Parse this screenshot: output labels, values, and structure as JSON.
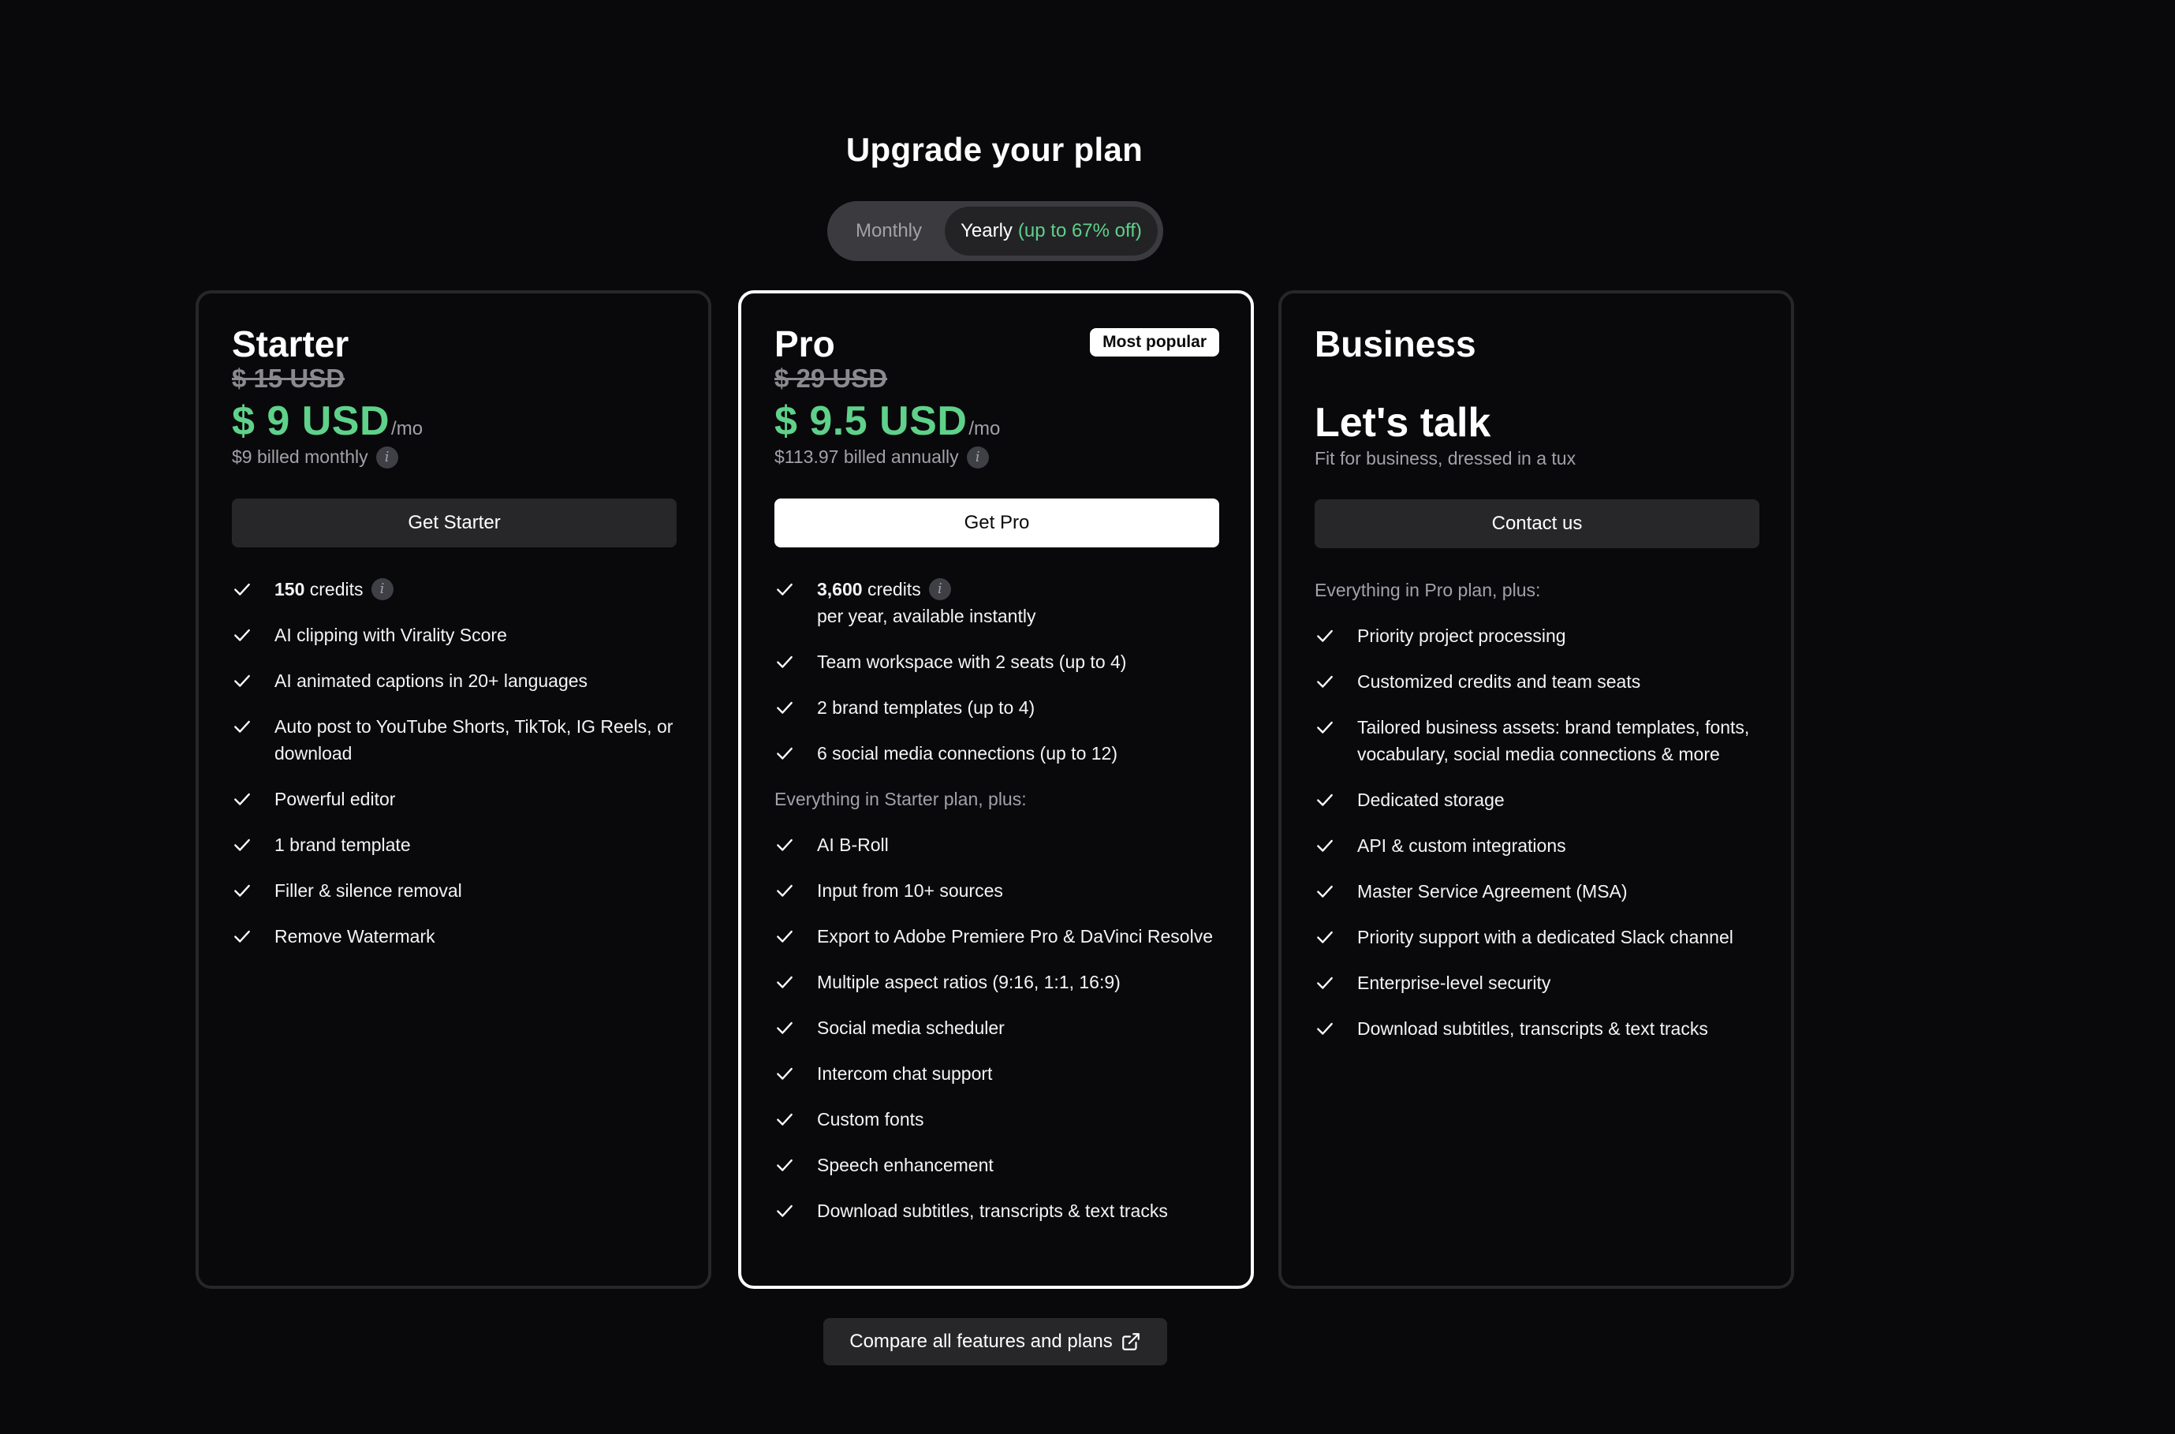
{
  "header": {
    "title": "Upgrade your plan",
    "billing_toggle": {
      "monthly_label": "Monthly",
      "yearly_label": "Yearly",
      "yearly_discount": "(up to 67% off)",
      "selected": "Yearly"
    }
  },
  "colors": {
    "background": "#09090b",
    "price_green": "#5fd18a",
    "card_border": "#27272a",
    "pro_border": "#ffffff"
  },
  "plans": {
    "starter": {
      "name": "Starter",
      "old_price": "$ 15 USD",
      "price": "$ 9 USD",
      "per": "/mo",
      "billed": "$9 billed monthly",
      "cta": "Get Starter",
      "features": [
        {
          "strong": "150",
          "text": " credits",
          "info": true
        },
        {
          "text": "AI clipping with Virality Score"
        },
        {
          "text": "AI animated captions in 20+ languages"
        },
        {
          "text": "Auto post to YouTube Shorts, TikTok, IG Reels, or download"
        },
        {
          "text": "Powerful editor"
        },
        {
          "text": "1 brand template"
        },
        {
          "text": "Filler & silence removal"
        },
        {
          "text": "Remove Watermark"
        }
      ]
    },
    "pro": {
      "name": "Pro",
      "badge": "Most popular",
      "old_price": "$ 29 USD",
      "price": "$ 9.5 USD",
      "per": "/mo",
      "billed": "$113.97 billed annually",
      "cta": "Get Pro",
      "features_top": [
        {
          "strong": "3,600",
          "text": " credits",
          "info": true,
          "sub": "per year, available instantly"
        },
        {
          "text": "Team workspace with 2 seats (up to 4)"
        },
        {
          "text": "2 brand templates (up to 4)"
        },
        {
          "text": "6 social media connections (up to 12)"
        }
      ],
      "subtitle": "Everything in Starter plan, plus:",
      "features_more": [
        {
          "text": "AI B-Roll"
        },
        {
          "text": "Input from 10+ sources"
        },
        {
          "text": "Export to Adobe Premiere Pro & DaVinci Resolve"
        },
        {
          "text": "Multiple aspect ratios (9:16, 1:1, 16:9)"
        },
        {
          "text": "Social media scheduler"
        },
        {
          "text": "Intercom chat support"
        },
        {
          "text": "Custom fonts"
        },
        {
          "text": "Speech enhancement"
        },
        {
          "text": "Download subtitles, transcripts & text tracks"
        }
      ]
    },
    "business": {
      "name": "Business",
      "headline": "Let's talk",
      "tagline": "Fit for business, dressed in a tux",
      "cta": "Contact us",
      "subtitle": "Everything in Pro plan, plus:",
      "features": [
        {
          "text": "Priority project processing"
        },
        {
          "text": "Customized credits and team seats"
        },
        {
          "text": "Tailored business assets: brand templates, fonts, vocabulary, social media connections & more"
        },
        {
          "text": "Dedicated storage"
        },
        {
          "text": "API & custom integrations"
        },
        {
          "text": "Master Service Agreement (MSA)"
        },
        {
          "text": "Priority support with a dedicated Slack channel"
        },
        {
          "text": "Enterprise-level security"
        },
        {
          "text": "Download subtitles, transcripts & text tracks"
        }
      ]
    }
  },
  "footer": {
    "compare_label": "Compare all features and plans",
    "compare_icon": "external-link-icon"
  }
}
